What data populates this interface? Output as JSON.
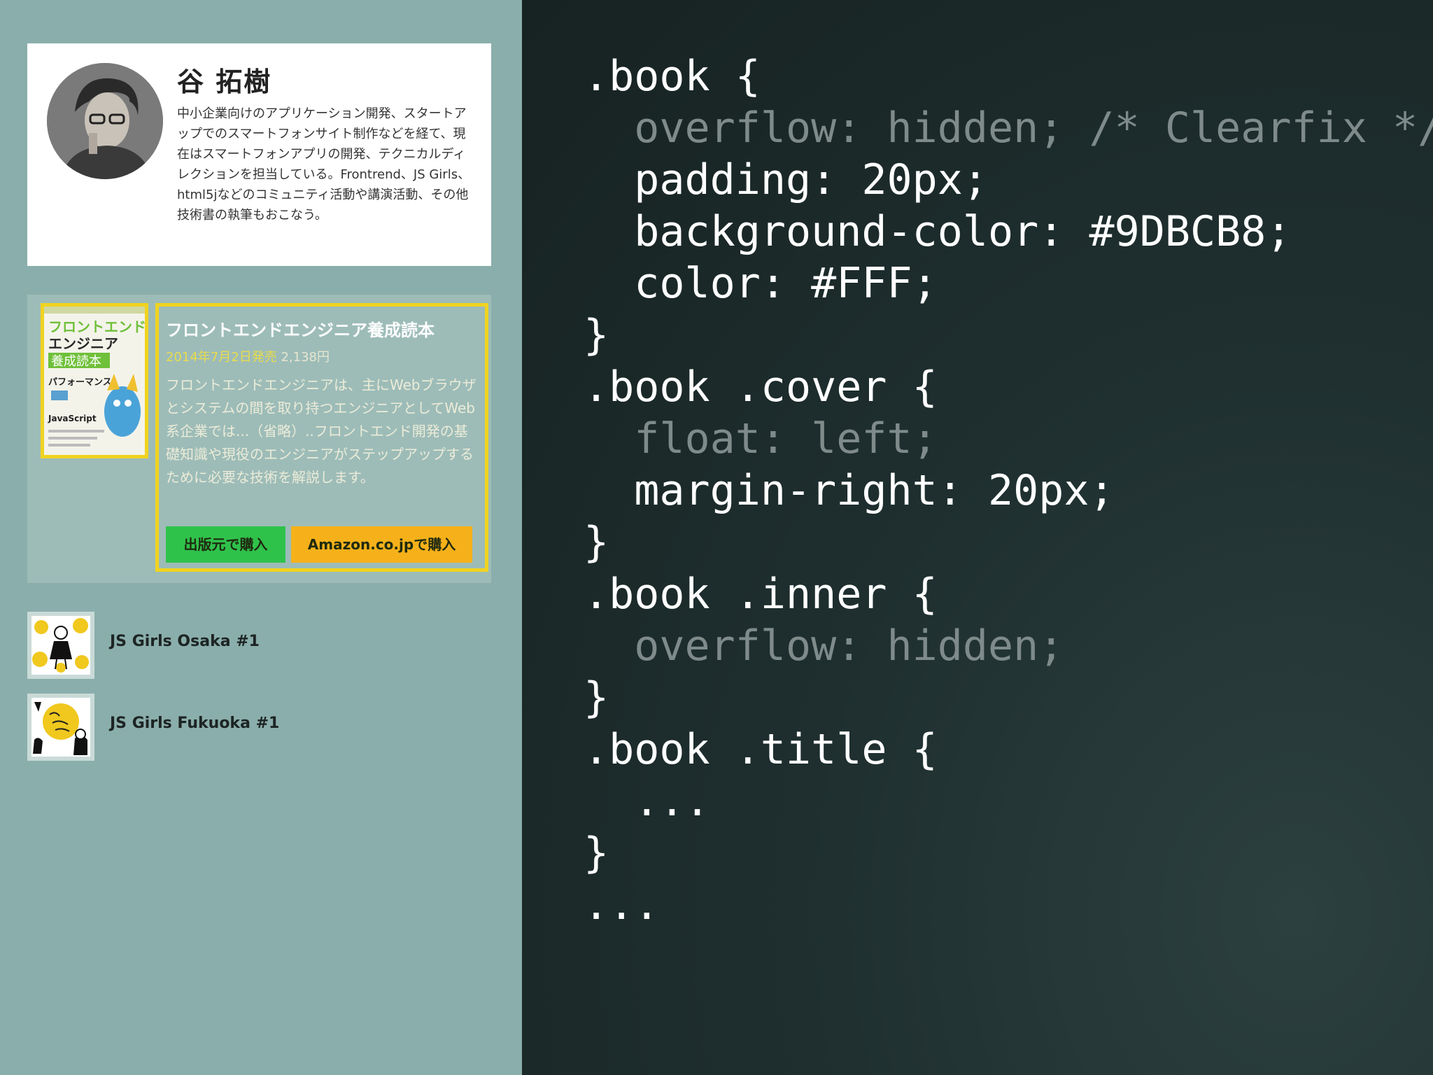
{
  "profile": {
    "name": "谷 拓樹",
    "bio": "中小企業向けのアプリケーション開発、スタートアップでのスマートフォンサイト制作などを経て、現在はスマートフォンアプリの開発、テクニカルディレクションを担当している。Frontrend、JS Girls、html5jなどのコミュニティ活動や講演活動、その他技術書の執筆もおこなう。"
  },
  "book": {
    "title": "フロントエンドエンジニア養成読本",
    "date": "2014年7月2日発売",
    "price": "2,138円",
    "description": "フロントエンドエンジニアは、主にWebブラウザとシステムの間を取り持つエンジニアとしてWeb系企業では...（省略）..フロントエンド開発の基礎知識や現役のエンジニアがステップアップするために必要な技術を解説します。",
    "cover_text": {
      "line1": "フロントエンド",
      "line2": "エンジニア",
      "line3": "養成読本",
      "line4": "パフォーマンス",
      "line5": "JavaScript"
    },
    "buttons": {
      "publisher": "出版元で購入",
      "amazon": "Amazon.co.jpで購入"
    }
  },
  "events": [
    {
      "label": "JS Girls Osaka #1"
    },
    {
      "label": "JS Girls Fukuoka #1"
    }
  ],
  "code": {
    "lines": [
      ".book {",
      "  overflow: hidden; /* Clearfix */",
      "  padding: 20px;",
      "  background-color: #9DBCB8;",
      "  color: #FFF;",
      "}",
      ".book .cover {",
      "  float: left;",
      "  margin-right: 20px;",
      "}",
      ".book .inner {",
      "  overflow: hidden;",
      "}",
      ".book .title {",
      "  ...",
      "}",
      "..."
    ]
  },
  "colors": {
    "left_bg": "#8aaeab",
    "book_bg": "#9DBCB8",
    "highlight": "#f0d320",
    "publisher_btn": "#2fc24b",
    "amazon_btn": "#f6b11a"
  }
}
